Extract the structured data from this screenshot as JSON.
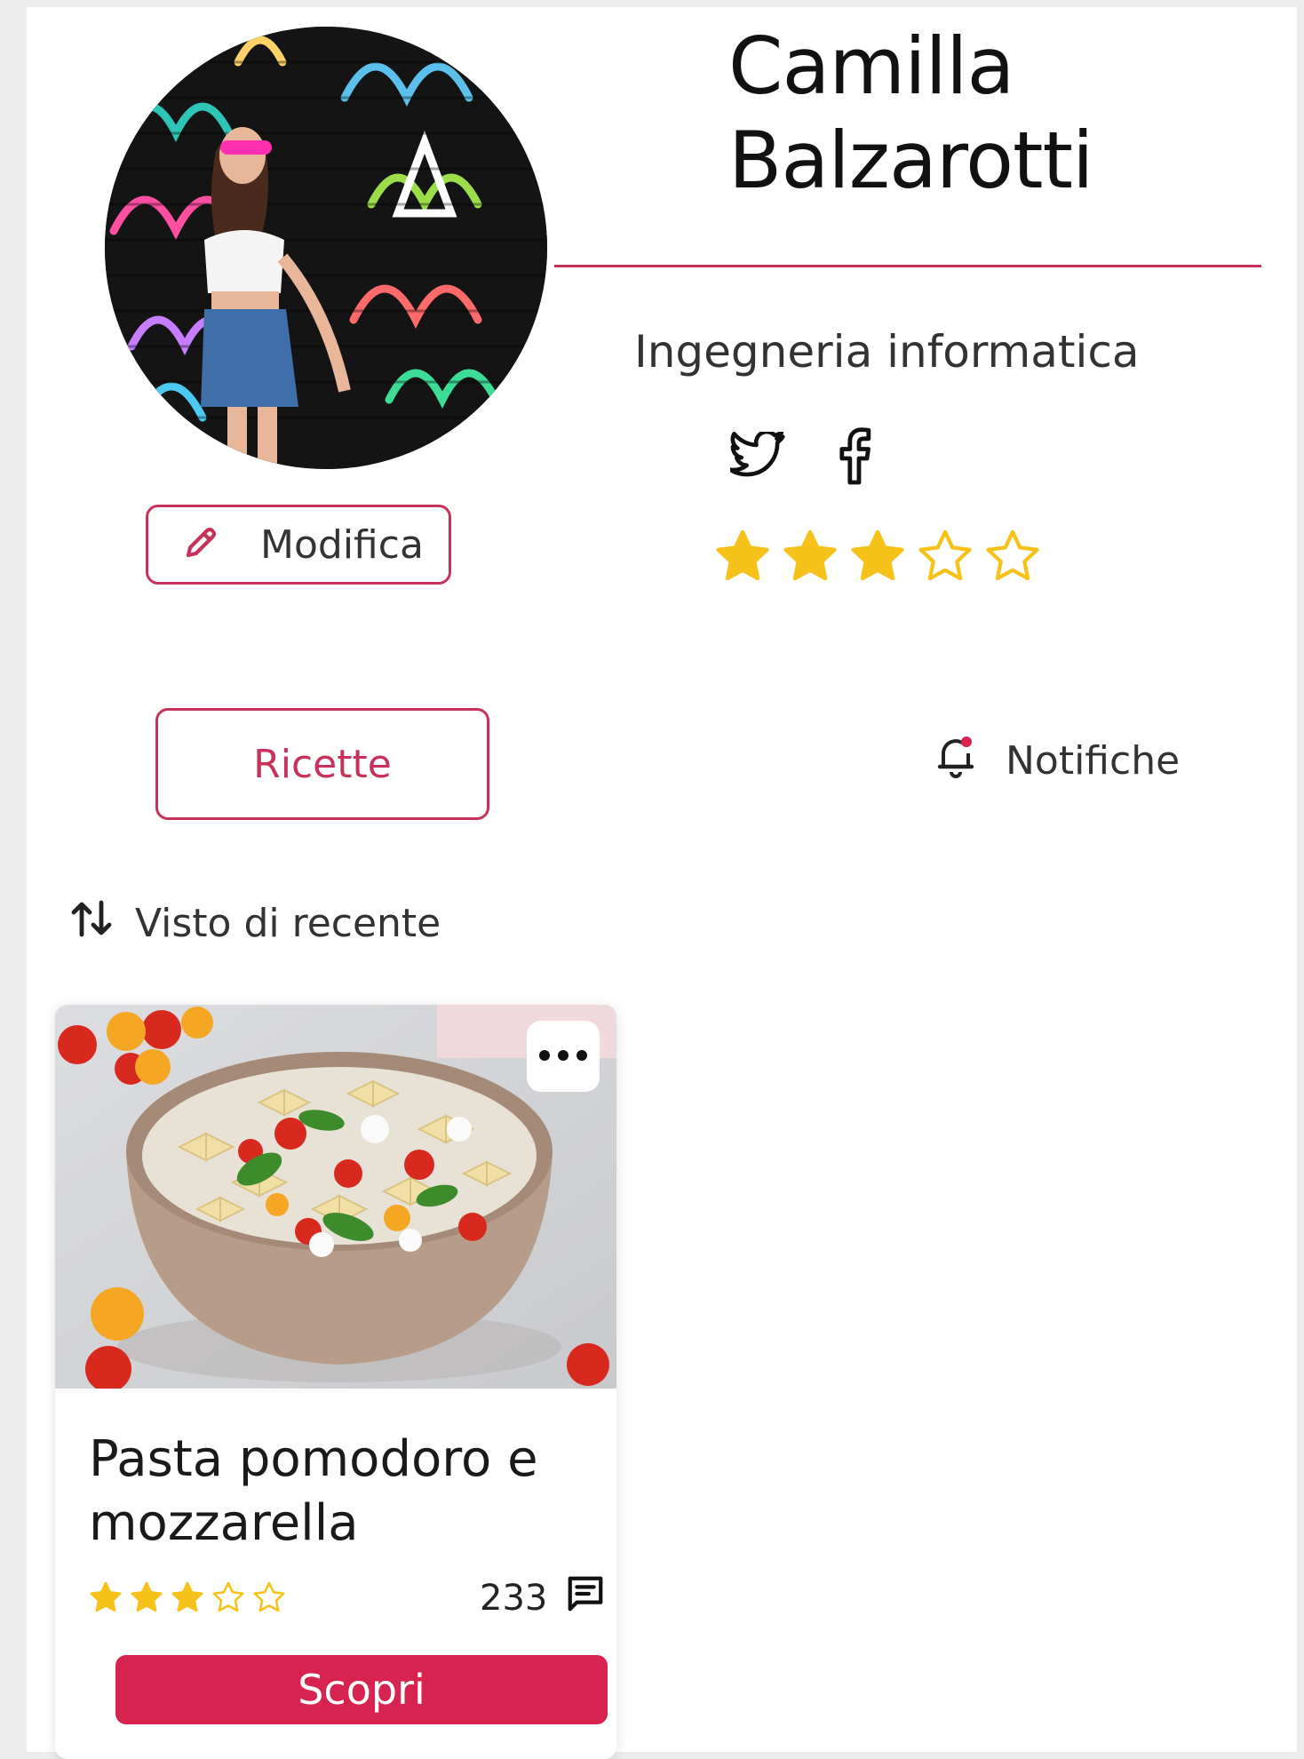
{
  "profile": {
    "name_line1": "Camilla",
    "name_line2": "Balzarotti",
    "course": "Ingegneria informatica",
    "rating": 3,
    "rating_max": 5,
    "edit_label": "Modifica",
    "socials": [
      "twitter-icon",
      "facebook-icon"
    ]
  },
  "tabs": {
    "recipes_label": "Ricette",
    "notifications_label": "Notifiche"
  },
  "sort": {
    "label": "Visto di recente",
    "icon": "sort-arrows-icon"
  },
  "recipe_card": {
    "title": "Pasta pomodoro e mozzarella",
    "rating": 3,
    "rating_max": 5,
    "comment_count": "233",
    "cta_label": "Scopri"
  },
  "colors": {
    "accent": "#c8325a",
    "cta": "#d6234f",
    "star": "#f6c21a"
  }
}
